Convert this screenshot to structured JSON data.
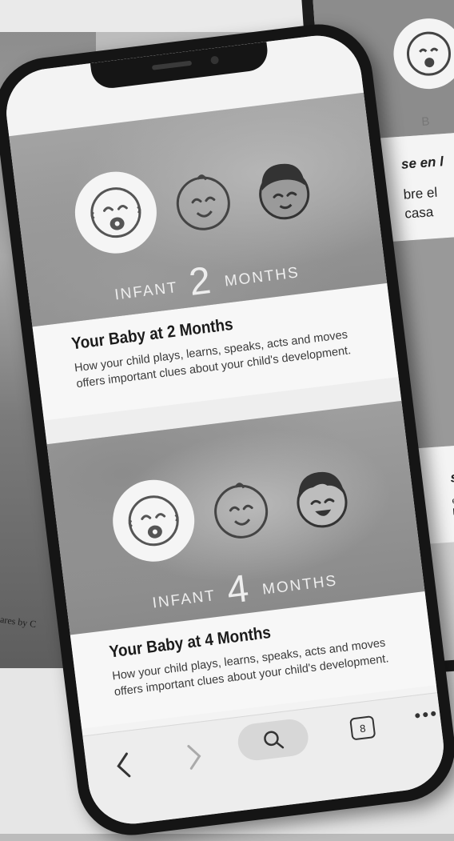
{
  "background": {
    "caption_fragment": "ares by C"
  },
  "back_phone": {
    "heading_fragment": "B",
    "text_line1": "se en l",
    "text_line2": "bre el",
    "text_line3": "casa",
    "label_fragment": "BÉ",
    "title_fragment": "se",
    "small_line1": "eg",
    "small_line2": "br"
  },
  "cards": [
    {
      "label_prefix": "INFANT",
      "number": "2",
      "label_suffix": "MONTHS",
      "title": "Your Baby at 2 Months",
      "description": "How your child plays, learns, speaks, acts and moves offers important clues about your child's development."
    },
    {
      "label_prefix": "INFANT",
      "number": "4",
      "label_suffix": "MONTHS",
      "title": "Your Baby at 4 Months",
      "description": "How your child plays, learns, speaks, acts and moves offers important clues about your child's development."
    }
  ],
  "toolbar": {
    "back_icon": "chevron-left-icon",
    "forward_icon": "chevron-right-icon",
    "search_icon": "search-icon",
    "tab_count": "8",
    "more_icon": "more-dots-icon"
  },
  "colors": {
    "screen_bg": "#f3f3f3",
    "phone_frame": "#151515",
    "photo_overlay": "#8d8d8d"
  }
}
